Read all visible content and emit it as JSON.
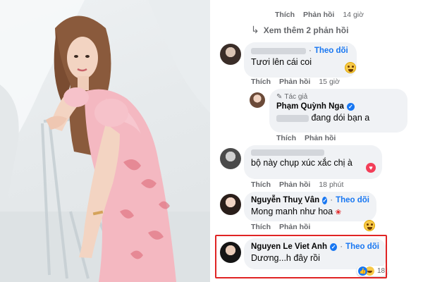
{
  "comments_section": {
    "top_meta": {
      "like_label": "Thích",
      "reply_label": "Phản hồi",
      "time": "14 giờ"
    },
    "more_replies": {
      "arrow_icon": "reply-arrow-icon",
      "label": "Xem thêm 2 phản hồi"
    },
    "items": [
      {
        "name_label": "",
        "follow_label": "Theo dõi",
        "text": "Tươi lên cái coi",
        "reaction_icon": "haha-emoji-icon",
        "meta": {
          "like_label": "Thích",
          "reply_label": "Phản hồi",
          "time": "15 giờ"
        }
      },
      {
        "author_tag": "Tác giả",
        "name_label": "Phạm Quỳnh Nga",
        "verified_icon": "verified-badge-icon",
        "text": "đang dói bạn a",
        "meta": {
          "like_label": "Thích",
          "reply_label": "Phản hồi",
          "time": ""
        }
      },
      {
        "name_label": "",
        "text": "bộ này chụp xúc xắc chị à",
        "reaction_icon": "heart-icon",
        "meta": {
          "like_label": "Thích",
          "reply_label": "Phản hồi",
          "time": "18 phút"
        }
      },
      {
        "name_label": "Nguyễn Thuỵ Vân",
        "verified_icon": "verified-badge-icon",
        "follow_label": "Theo dõi",
        "text": "Mong manh như hoa",
        "reaction_icon": "haha-emoji-icon",
        "meta": {
          "like_label": "Thích",
          "reply_label": "Phản hồi",
          "time": ""
        }
      },
      {
        "name_label": "Nguyen Le Viet Anh",
        "verified_icon": "verified-badge-icon",
        "follow_label": "Theo dõi",
        "text": "Dương...h đây rồi",
        "reaction_count": "18",
        "reaction_icons": [
          "like-icon",
          "haha-emoji-icon"
        ]
      }
    ]
  },
  "colors": {
    "link_blue": "#1877f2",
    "bubble_bg": "#f0f2f5",
    "highlight_red": "#e02424",
    "dress_pink": "#f4b8c1"
  }
}
